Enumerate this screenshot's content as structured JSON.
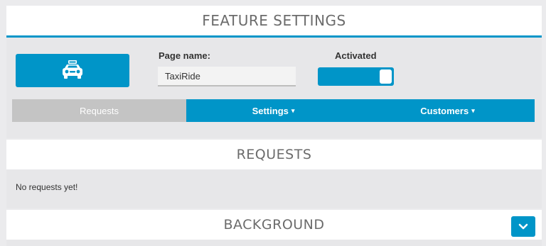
{
  "header": {
    "title": "FEATURE SETTINGS"
  },
  "feature": {
    "icon": "taxi-icon",
    "page_name_label": "Page name:",
    "page_name_value": "TaxiRide",
    "activated_label": "Activated",
    "activated": true
  },
  "tabs": [
    {
      "label": "Requests",
      "caret": ""
    },
    {
      "label": "Settings",
      "caret": "▾"
    },
    {
      "label": "Customers",
      "caret": "▾"
    }
  ],
  "requests": {
    "title": "REQUESTS",
    "empty_text": "No requests yet!"
  },
  "background": {
    "title": "BACKGROUND",
    "expand_icon": "chevron-down-icon"
  },
  "colors": {
    "accent": "#0095c8",
    "inactive_tab": "#c4c4c4",
    "panel": "#e7e7e9"
  }
}
